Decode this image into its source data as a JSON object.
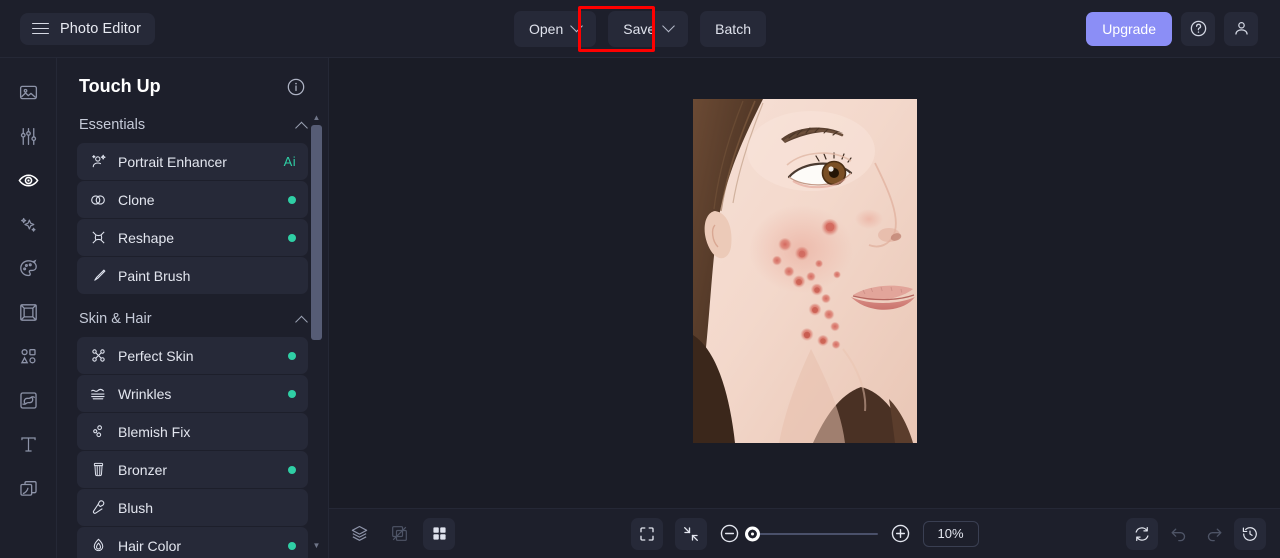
{
  "app": {
    "brand_title": "Photo Editor",
    "menu_icon": "hamburger-icon"
  },
  "header": {
    "tools": [
      {
        "label": "Open",
        "has_caret": true,
        "highlighted": true
      },
      {
        "label": "Save",
        "has_caret": true,
        "highlighted": false
      },
      {
        "label": "Batch",
        "has_caret": false,
        "highlighted": false
      }
    ],
    "upgrade_label": "Upgrade",
    "help_icon": "question-circle-icon",
    "account_icon": "user-icon",
    "highlight_color": "#fe0000"
  },
  "rail": {
    "items": [
      {
        "icon": "image-icon",
        "name": "image",
        "active": false
      },
      {
        "icon": "sliders-icon",
        "name": "adjust",
        "active": false
      },
      {
        "icon": "eye-icon",
        "name": "retouch",
        "active": true
      },
      {
        "icon": "sparkles-icon",
        "name": "effects",
        "active": false
      },
      {
        "icon": "palette-icon",
        "name": "color",
        "active": false
      },
      {
        "icon": "frame-icon",
        "name": "frames",
        "active": false
      },
      {
        "icon": "shapes-icon",
        "name": "elements",
        "active": false
      },
      {
        "icon": "mask-icon",
        "name": "mask",
        "active": false
      },
      {
        "icon": "text-icon",
        "name": "text",
        "active": false
      },
      {
        "icon": "layers-stack-icon",
        "name": "layers",
        "active": false
      }
    ]
  },
  "panel": {
    "title": "Touch Up",
    "info_icon": "info-circle-icon",
    "groups": [
      {
        "title": "Essentials",
        "expanded": true,
        "tools": [
          {
            "label": "Portrait Enhancer",
            "icon": "portrait-enhance-icon",
            "badge": "Ai",
            "dot": false
          },
          {
            "label": "Clone",
            "icon": "clone-icon",
            "badge": "",
            "dot": true
          },
          {
            "label": "Reshape",
            "icon": "reshape-icon",
            "badge": "",
            "dot": true
          },
          {
            "label": "Paint Brush",
            "icon": "paint-brush-icon",
            "badge": "",
            "dot": false
          }
        ]
      },
      {
        "title": "Skin & Hair",
        "expanded": true,
        "tools": [
          {
            "label": "Perfect Skin",
            "icon": "perfect-skin-icon",
            "badge": "",
            "dot": true
          },
          {
            "label": "Wrinkles",
            "icon": "wrinkles-icon",
            "badge": "",
            "dot": true
          },
          {
            "label": "Blemish Fix",
            "icon": "blemish-fix-icon",
            "badge": "",
            "dot": false
          },
          {
            "label": "Bronzer",
            "icon": "bronzer-icon",
            "badge": "",
            "dot": true
          },
          {
            "label": "Blush",
            "icon": "blush-icon",
            "badge": "",
            "dot": false
          },
          {
            "label": "Hair Color",
            "icon": "hair-color-icon",
            "badge": "",
            "dot": true
          }
        ]
      }
    ],
    "scrollbar": {
      "up_arrow": "▲",
      "down_arrow": "▼"
    }
  },
  "canvas": {
    "image_alt": "portrait-photo-woman-with-acne"
  },
  "bottombar": {
    "left_buttons": [
      {
        "icon": "layers-icon",
        "name": "layers-toggle",
        "dim": false,
        "filled": false
      },
      {
        "icon": "compare-icon",
        "name": "before-after-compare",
        "dim": true,
        "filled": false
      },
      {
        "icon": "grid-icon",
        "name": "grid-view",
        "dim": false,
        "filled": true
      }
    ],
    "center_buttons": [
      {
        "icon": "fit-screen-icon",
        "name": "fit-to-screen",
        "filled": true
      },
      {
        "icon": "shrink-icon",
        "name": "actual-size",
        "filled": true
      }
    ],
    "zoom_out_icon": "zoom-out-circle-icon",
    "zoom_in_icon": "zoom-in-circle-icon",
    "zoom_value": "10%",
    "zoom_slider_percent": 0,
    "right_buttons": [
      {
        "icon": "reset-icon",
        "name": "reset",
        "dim": false,
        "filled": true
      },
      {
        "icon": "undo-icon",
        "name": "undo",
        "dim": true,
        "filled": false
      },
      {
        "icon": "redo-icon",
        "name": "redo",
        "dim": true,
        "filled": false
      },
      {
        "icon": "history-icon",
        "name": "history",
        "dim": false,
        "filled": true
      }
    ]
  },
  "colors": {
    "accent": "#8b8ef6",
    "status_dot": "#2fcfa5",
    "ai_badge": "#2fcfa5",
    "panel_bg": "#1d1f2b",
    "canvas_bg": "#1a1c26",
    "highlight": "#fe0000"
  }
}
